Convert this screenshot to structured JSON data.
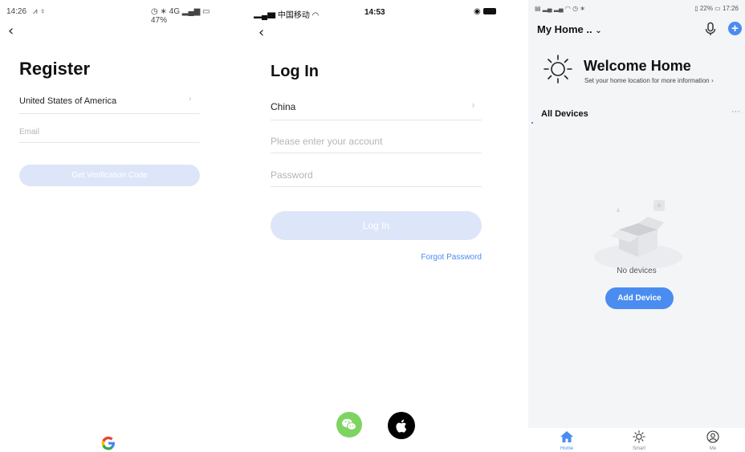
{
  "register": {
    "status": {
      "time": "14:26",
      "icons": "◷ ∗ 4G",
      "battery": "47%"
    },
    "title": "Register",
    "country": "United States of America",
    "email_placeholder": "Email",
    "verify_button": "Get Verification Code",
    "colors": {
      "button_disabled": "#dde6f8"
    }
  },
  "login": {
    "status": {
      "carrier": "中国移动",
      "time": "14:53"
    },
    "title": "Log In",
    "country": "China",
    "account_placeholder": "Please enter your account",
    "password_placeholder": "Password",
    "login_button": "Log In",
    "forgot_password": "Forgot Password",
    "colors": {
      "button_disabled": "#dde6f8",
      "link": "#4a8cf0",
      "wechat": "#7dd461"
    }
  },
  "home": {
    "status": {
      "battery": "22%",
      "time": "17:26"
    },
    "home_selector": "My Home ..",
    "welcome_title": "Welcome Home",
    "welcome_subtitle": "Set your home location for more information",
    "section_title": "All Devices",
    "more": "···",
    "empty_text": "No devices",
    "add_device": "Add Device",
    "tabs": [
      {
        "label": "Home",
        "icon": "home-icon"
      },
      {
        "label": "Smart",
        "icon": "sun-icon"
      },
      {
        "label": "Me",
        "icon": "user-icon"
      }
    ],
    "colors": {
      "accent": "#4a8cf0",
      "background": "#f4f5f7"
    }
  }
}
